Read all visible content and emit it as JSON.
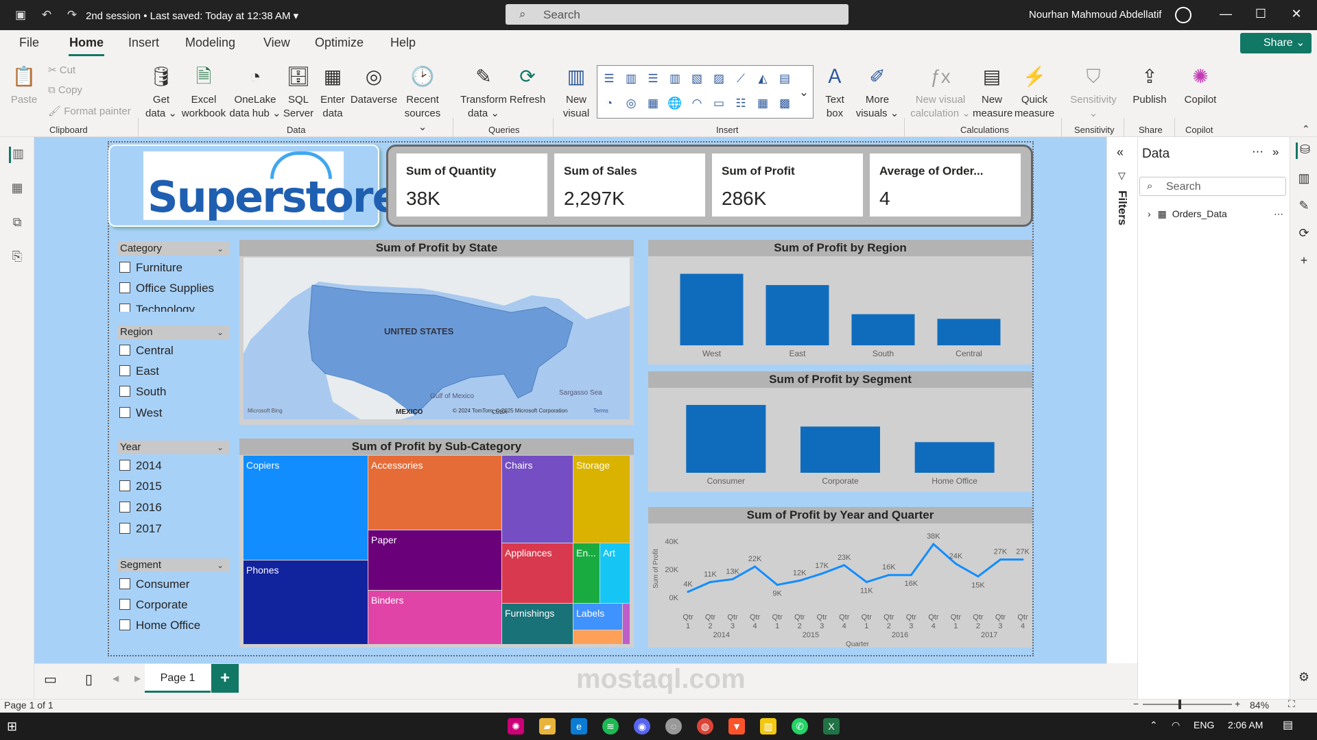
{
  "titlebar": {
    "session": "2nd session",
    "saved": "• Last saved: Today at 12:38 AM",
    "search_placeholder": "Search",
    "user": "Nourhan Mahmoud Abdellatif"
  },
  "menu": [
    "File",
    "Home",
    "Insert",
    "Modeling",
    "View",
    "Optimize",
    "Help"
  ],
  "share_label": "Share",
  "ribbon": {
    "clipboard": {
      "paste": "Paste",
      "cut": "Cut",
      "copy": "Copy",
      "format_painter": "Format painter",
      "group": "Clipboard"
    },
    "data": {
      "get_data": [
        "Get",
        "data ⌄"
      ],
      "excel": [
        "Excel",
        "workbook"
      ],
      "onelake": [
        "OneLake",
        "data hub ⌄"
      ],
      "sql": [
        "SQL",
        "Server"
      ],
      "enter": [
        "Enter",
        "data"
      ],
      "dataverse": [
        "Dataverse",
        ""
      ],
      "recent": [
        "Recent",
        "sources ⌄"
      ],
      "group": "Data"
    },
    "queries": {
      "transform": [
        "Transform",
        "data ⌄"
      ],
      "refresh": [
        "Refresh",
        ""
      ],
      "group": "Queries"
    },
    "insert": {
      "new_visual": [
        "New",
        "visual"
      ],
      "text_box": [
        "Text",
        "box"
      ],
      "more_visuals": [
        "More",
        "visuals ⌄"
      ],
      "group": "Insert"
    },
    "calculations": {
      "new_visual_calc": [
        "New visual",
        "calculation ⌄"
      ],
      "new_measure": [
        "New",
        "measure"
      ],
      "quick_measure": [
        "Quick",
        "measure"
      ],
      "group": "Calculations"
    },
    "sensitivity": {
      "label": [
        "Sensitivity",
        "⌄"
      ],
      "group": "Sensitivity"
    },
    "share": {
      "publish": [
        "Publish",
        ""
      ],
      "group": "Share"
    },
    "copilot": {
      "label": [
        "Copilot",
        ""
      ],
      "group": "Copilot"
    }
  },
  "kpis": [
    {
      "label": "Sum of Quantity",
      "value": "38K"
    },
    {
      "label": "Sum of Sales",
      "value": "2,297K"
    },
    {
      "label": "Sum of Profit",
      "value": "286K"
    },
    {
      "label": "Average of Order...",
      "value": "4"
    }
  ],
  "logo_text": "Superstore",
  "slicers": [
    {
      "title": "Category",
      "items": [
        "Furniture",
        "Office Supplies",
        "Technology"
      ]
    },
    {
      "title": "Region",
      "items": [
        "Central",
        "East",
        "South",
        "West"
      ]
    },
    {
      "title": "Year",
      "items": [
        "2014",
        "2015",
        "2016",
        "2017"
      ]
    },
    {
      "title": "Segment",
      "items": [
        "Consumer",
        "Corporate",
        "Home Office"
      ]
    }
  ],
  "map": {
    "title": "Sum of Profit by State",
    "labels": {
      "country": "UNITED STATES",
      "gulf": "Gulf of Mexico",
      "sea": "Sargasso Sea",
      "mexico": "MEXICO",
      "bing": "Microsoft Bing",
      "copyright": "© 2024 TomTom, © 2025 Microsoft Corporation",
      "terms": "Terms",
      "cuba": "CUBA"
    }
  },
  "treemap": {
    "title": "Sum of Profit by Sub-Category",
    "tiles": [
      {
        "label": "Copiers",
        "color": "#118dff"
      },
      {
        "label": "Phones",
        "color": "#12239e"
      },
      {
        "label": "Accessories",
        "color": "#e66c37"
      },
      {
        "label": "Paper",
        "color": "#6b007b"
      },
      {
        "label": "Binders",
        "color": "#e044a7"
      },
      {
        "label": "Chairs",
        "color": "#744ec2"
      },
      {
        "label": "Appliances",
        "color": "#d9394e"
      },
      {
        "label": "Furnishings",
        "color": "#197278"
      },
      {
        "label": "Storage",
        "color": "#d9b300"
      },
      {
        "label": "En...",
        "color": "#1aab40"
      },
      {
        "label": "Art",
        "color": "#15c6f4"
      },
      {
        "label": "Labels",
        "color": "#4092ff"
      },
      {
        "label": "",
        "color": "#ffa058"
      },
      {
        "label": "",
        "color": "#be5dc9"
      }
    ]
  },
  "chart_data": [
    {
      "type": "bar",
      "title": "Sum of Profit by Region",
      "categories": [
        "West",
        "East",
        "South",
        "Central"
      ],
      "values": [
        108,
        91,
        47,
        40
      ],
      "ylim": [
        0,
        120
      ],
      "color": "#0f6cbd"
    },
    {
      "type": "bar",
      "title": "Sum of Profit by Segment",
      "categories": [
        "Consumer",
        "Corporate",
        "Home Office"
      ],
      "values": [
        135,
        92,
        61
      ],
      "ylim": [
        0,
        150
      ],
      "color": "#0f6cbd"
    },
    {
      "type": "line",
      "title": "Sum of Profit by Year and Quarter",
      "ylabel": "Sum of Profit",
      "xlabel": "Quarter",
      "x": [
        "Qtr 1",
        "Qtr 2",
        "Qtr 3",
        "Qtr 4",
        "Qtr 1",
        "Qtr 2",
        "Qtr 3",
        "Qtr 4",
        "Qtr 1",
        "Qtr 2",
        "Qtr 3",
        "Qtr 4",
        "Qtr 1",
        "Qtr 2",
        "Qtr 3",
        "Qtr 4"
      ],
      "years": [
        "2014",
        "2015",
        "2016",
        "2017"
      ],
      "values": [
        4,
        11,
        13,
        22,
        9,
        12,
        17,
        23,
        11,
        16,
        16,
        38,
        24,
        15,
        27,
        27
      ],
      "data_labels": [
        "4K",
        "11K",
        "13K",
        "22K",
        "9K",
        "12K",
        "17K",
        "23K",
        "11K",
        "16K",
        "16K",
        "38K",
        "24K",
        "15K",
        "27K",
        "27K"
      ],
      "yticks": [
        "0K",
        "20K",
        "40K"
      ],
      "ylim": [
        0,
        40
      ],
      "color": "#118dff"
    }
  ],
  "data_pane": {
    "title": "Data",
    "search_placeholder": "Search",
    "table": "Orders_Data",
    "filters": "Filters"
  },
  "pages": {
    "tab": "Page 1",
    "add": "+"
  },
  "status": {
    "page": "Page 1 of 1",
    "zoom": "84%"
  },
  "taskbar": {
    "lang": "ENG",
    "time": "2:06 AM"
  },
  "watermark": "mostaql.com"
}
